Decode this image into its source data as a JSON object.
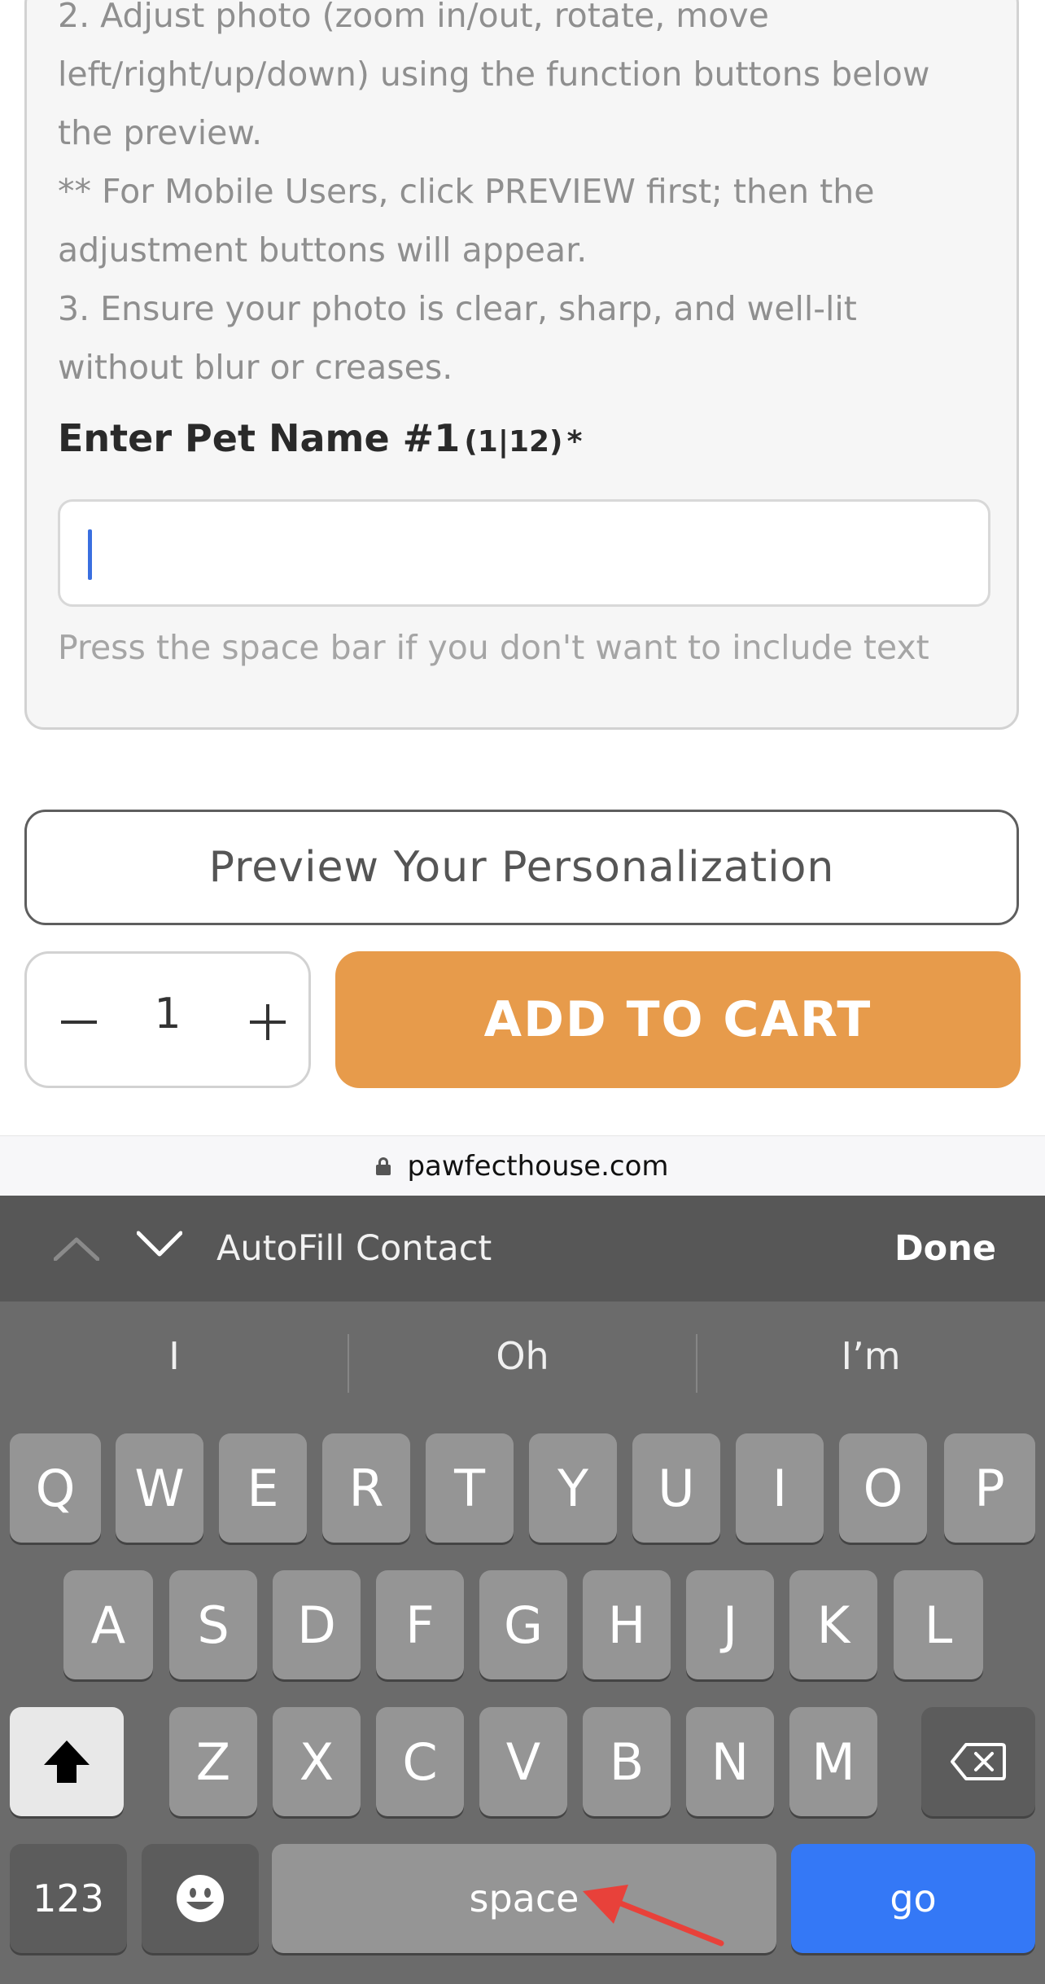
{
  "instructions": {
    "lines": [
      "2. Adjust photo (zoom in/out, rotate, move",
      "left/right/up/down) using the function buttons below",
      "the preview.",
      "** For Mobile Users, click PREVIEW first; then the",
      "adjustment buttons will appear.",
      "3. Ensure your photo is clear, sharp, and well-lit",
      "without blur or creases."
    ]
  },
  "pet_name_field": {
    "label": "Enter Pet Name #1",
    "counter": "(1|12)",
    "required_mark": "*",
    "value": "",
    "hint": "Press the space bar if you don't want to include text"
  },
  "actions": {
    "preview_label": "Preview Your Personalization",
    "quantity": "1",
    "add_to_cart_label": "ADD TO CART"
  },
  "browser": {
    "domain": "pawfecthouse.com"
  },
  "keyboard": {
    "accessory": {
      "autofill_label": "AutoFill Contact",
      "done_label": "Done"
    },
    "suggestions": [
      "I",
      "Oh",
      "I’m"
    ],
    "row1": [
      "Q",
      "W",
      "E",
      "R",
      "T",
      "Y",
      "U",
      "I",
      "O",
      "P"
    ],
    "row2": [
      "A",
      "S",
      "D",
      "F",
      "G",
      "H",
      "J",
      "K",
      "L"
    ],
    "row3": [
      "Z",
      "X",
      "C",
      "V",
      "B",
      "N",
      "M"
    ],
    "numbers_label": "123",
    "space_label": "space",
    "go_label": "go"
  },
  "colors": {
    "add_to_cart": "#e79b4b",
    "go_key": "#3478f6",
    "annotation_arrow": "#e8413a"
  }
}
